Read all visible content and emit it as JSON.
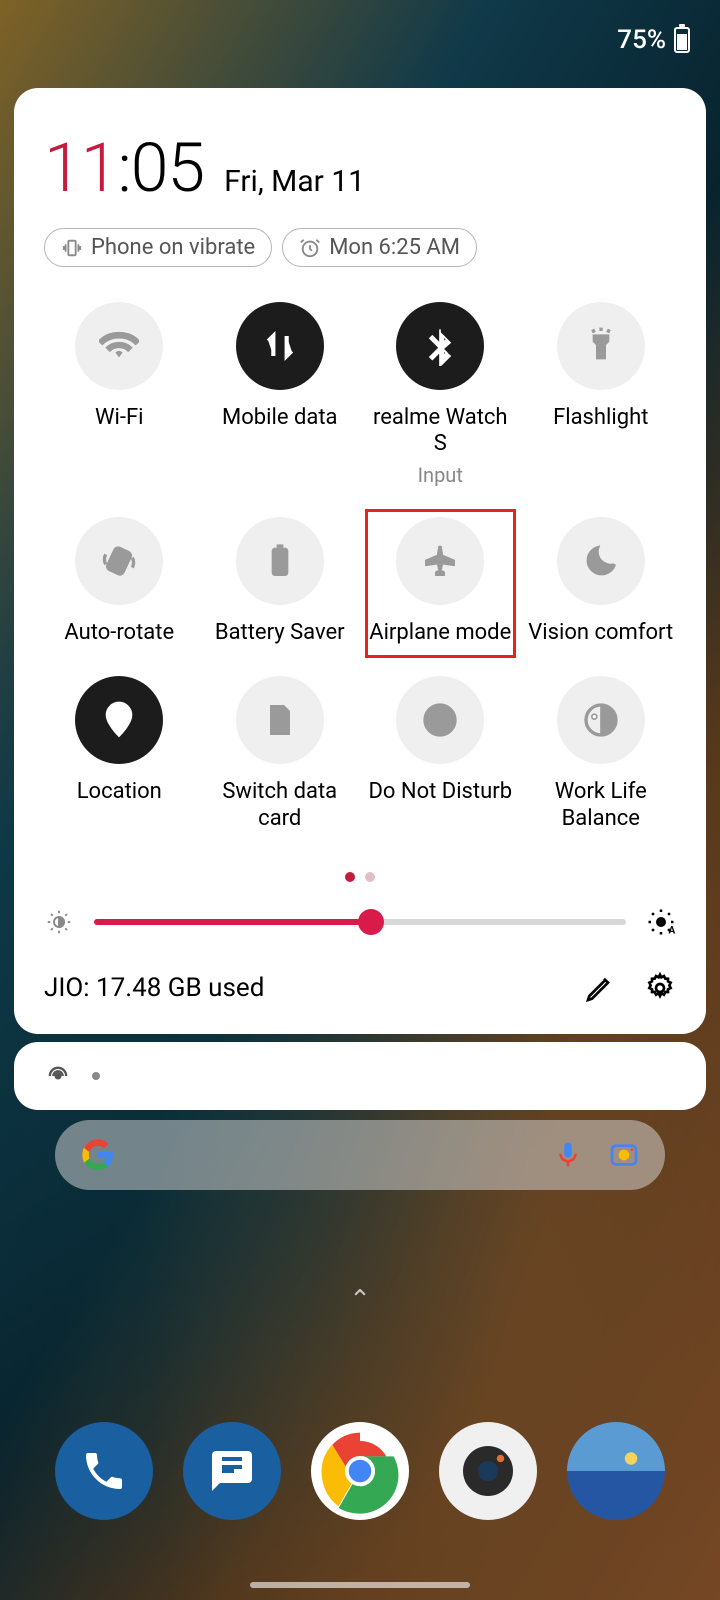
{
  "status": {
    "battery_pct": "75%"
  },
  "clock": {
    "hour": "11",
    "minute": ":05",
    "date": "Fri, Mar 11"
  },
  "chips": {
    "vibrate": "Phone on vibrate",
    "alarm": "Mon 6:25 AM"
  },
  "tiles": [
    {
      "label": "Wi-Fi",
      "state": "off",
      "icon": "wifi"
    },
    {
      "label": "Mobile data",
      "state": "on",
      "icon": "data"
    },
    {
      "label": "realme Watch S",
      "sublabel": "Input",
      "state": "on",
      "icon": "bluetooth"
    },
    {
      "label": "Flashlight",
      "state": "off",
      "icon": "flashlight"
    },
    {
      "label": "Auto-rotate",
      "state": "off",
      "icon": "rotate"
    },
    {
      "label": "Battery Saver",
      "state": "off",
      "icon": "battery-saver"
    },
    {
      "label": "Airplane mode",
      "state": "off",
      "icon": "airplane",
      "highlighted": true
    },
    {
      "label": "Vision comfort",
      "state": "off",
      "icon": "moon"
    },
    {
      "label": "Location",
      "state": "on",
      "icon": "location"
    },
    {
      "label": "Switch data card",
      "state": "off",
      "icon": "sim"
    },
    {
      "label": "Do Not Disturb",
      "state": "off",
      "icon": "dnd"
    },
    {
      "label": "Work Life Balance",
      "state": "off",
      "icon": "wlb"
    }
  ],
  "brightness": {
    "value_pct": 52
  },
  "footer": {
    "data_usage": "JIO: 17.48 GB used"
  },
  "pager": {
    "current": 1,
    "total": 2
  }
}
